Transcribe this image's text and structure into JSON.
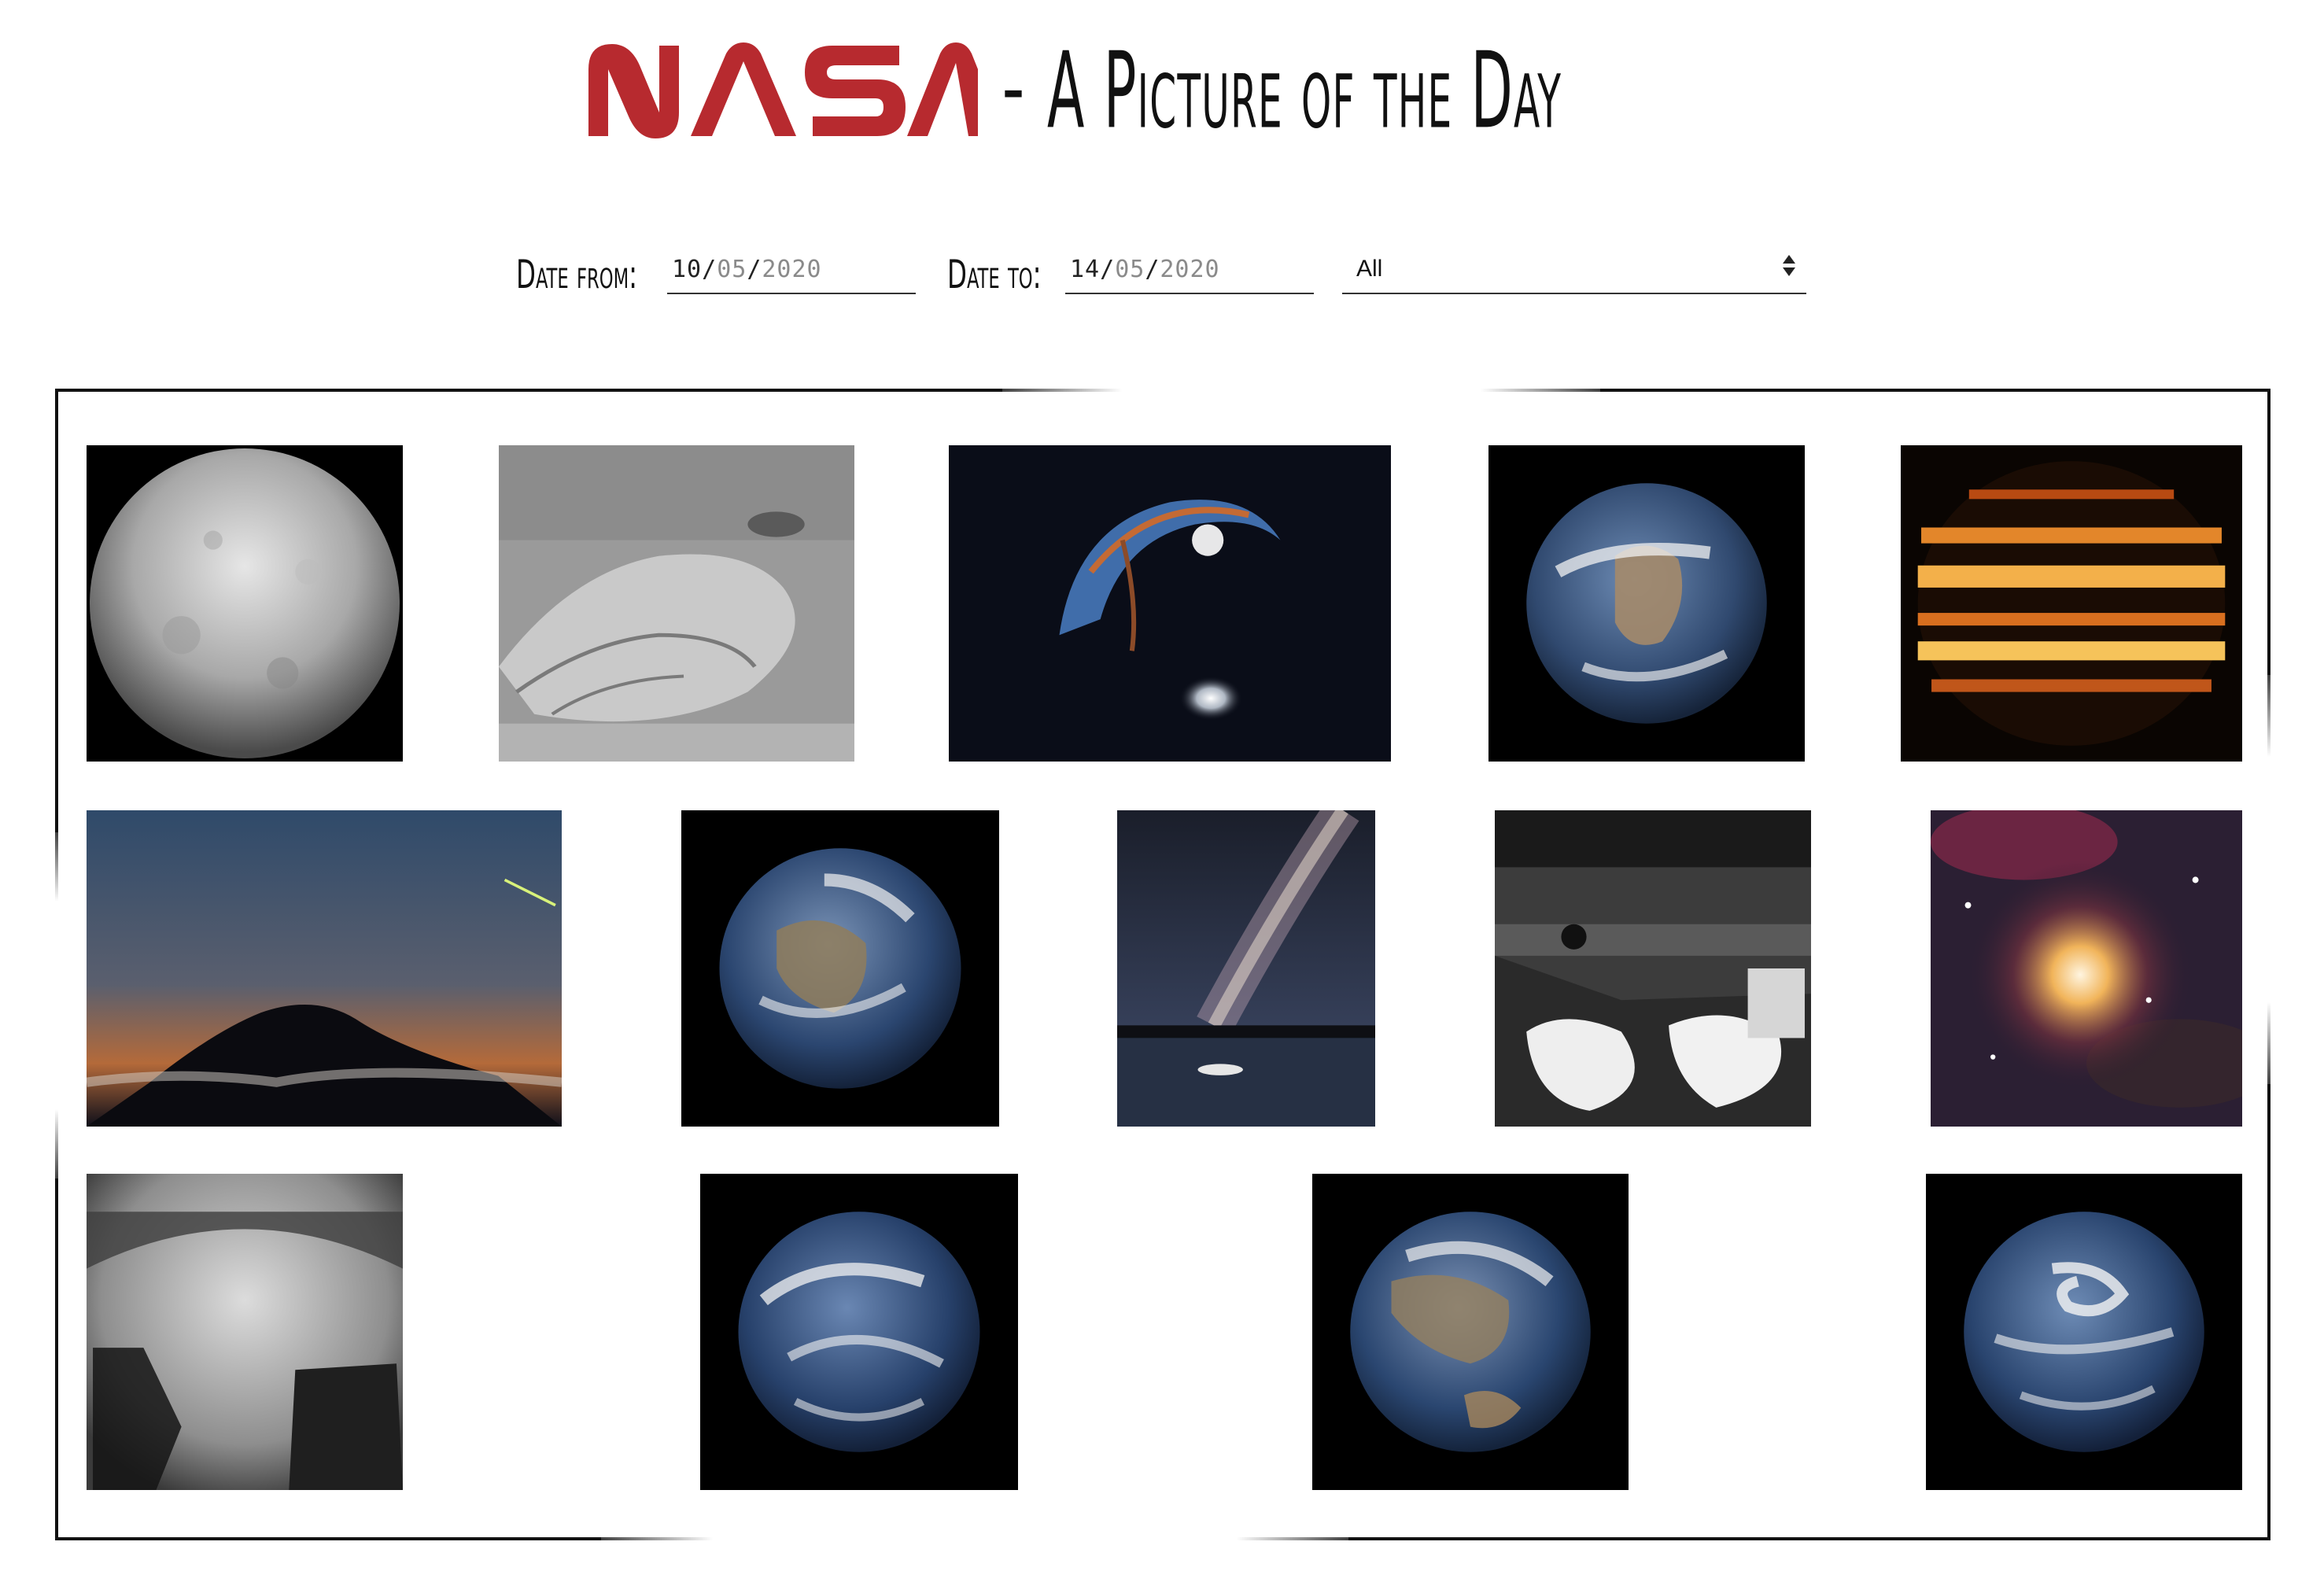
{
  "header": {
    "logo_text": "NASA",
    "logo_color": "#b72a2f",
    "separator": "-",
    "title": "A Picture of the Day"
  },
  "filters": {
    "date_from": {
      "label": "Date from:",
      "day": "10",
      "month": "05",
      "year": "2020"
    },
    "date_to": {
      "label": "Date to:",
      "day": "14",
      "month": "05",
      "year": "2020"
    },
    "media_type": {
      "selected": "All"
    }
  },
  "gallery": {
    "images": [
      {
        "subject": "gray-moon-sphere"
      },
      {
        "subject": "mars-rock-outcrop"
      },
      {
        "subject": "heron-galaxies"
      },
      {
        "subject": "earth-africa-view"
      },
      {
        "subject": "jupiter-infrared"
      },
      {
        "subject": "meteor-over-mountain"
      },
      {
        "subject": "earth-asia-view"
      },
      {
        "subject": "milky-way-lake-boat"
      },
      {
        "subject": "rover-deck"
      },
      {
        "subject": "red-giant-star-field"
      },
      {
        "subject": "rover-fisheye-shadow"
      },
      {
        "subject": "earth-pacific-view"
      },
      {
        "subject": "earth-asia-australia-view"
      },
      {
        "subject": "earth-pacific-swirl-view"
      }
    ]
  }
}
